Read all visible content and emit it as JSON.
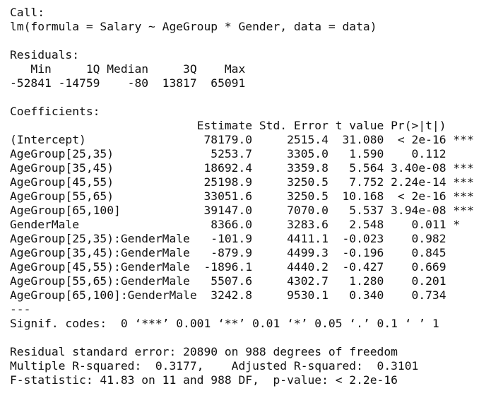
{
  "console": {
    "lines": [
      "Call:",
      "lm(formula = Salary ~ AgeGroup * Gender, data = data)",
      "",
      "Residuals:",
      "   Min     1Q Median     3Q    Max ",
      "-52841 -14759    -80  13817  65091 ",
      "",
      "Coefficients:",
      "                           Estimate Std. Error t value Pr(>|t|)    ",
      "(Intercept)                 78179.0     2515.4  31.080  < 2e-16 ***",
      "AgeGroup[25,35)              5253.7     3305.0   1.590    0.112    ",
      "AgeGroup[35,45)             18692.4     3359.8   5.564 3.40e-08 ***",
      "AgeGroup[45,55)             25198.9     3250.5   7.752 2.24e-14 ***",
      "AgeGroup[55,65)             33051.6     3250.5  10.168  < 2e-16 ***",
      "AgeGroup[65,100]            39147.0     7070.0   5.537 3.94e-08 ***",
      "GenderMale                   8366.0     3283.6   2.548    0.011 *  ",
      "AgeGroup[25,35):GenderMale   -101.9     4411.1  -0.023    0.982    ",
      "AgeGroup[35,45):GenderMale   -879.9     4499.3  -0.196    0.845    ",
      "AgeGroup[45,55):GenderMale  -1896.1     4440.2  -0.427    0.669    ",
      "AgeGroup[55,65):GenderMale   5507.6     4302.7   1.280    0.201    ",
      "AgeGroup[65,100]:GenderMale  3242.8     9530.1   0.340    0.734    ",
      "---",
      "Signif. codes:  0 ‘***’ 0.001 ‘**’ 0.01 ‘*’ 0.05 ‘.’ 0.1 ‘ ’ 1",
      "",
      "Residual standard error: 20890 on 988 degrees of freedom",
      "Multiple R-squared:  0.3177,\tAdjusted R-squared:  0.3101 ",
      "F-statistic: 41.83 on 11 and 988 DF,  p-value: < 2.2e-16"
    ]
  }
}
